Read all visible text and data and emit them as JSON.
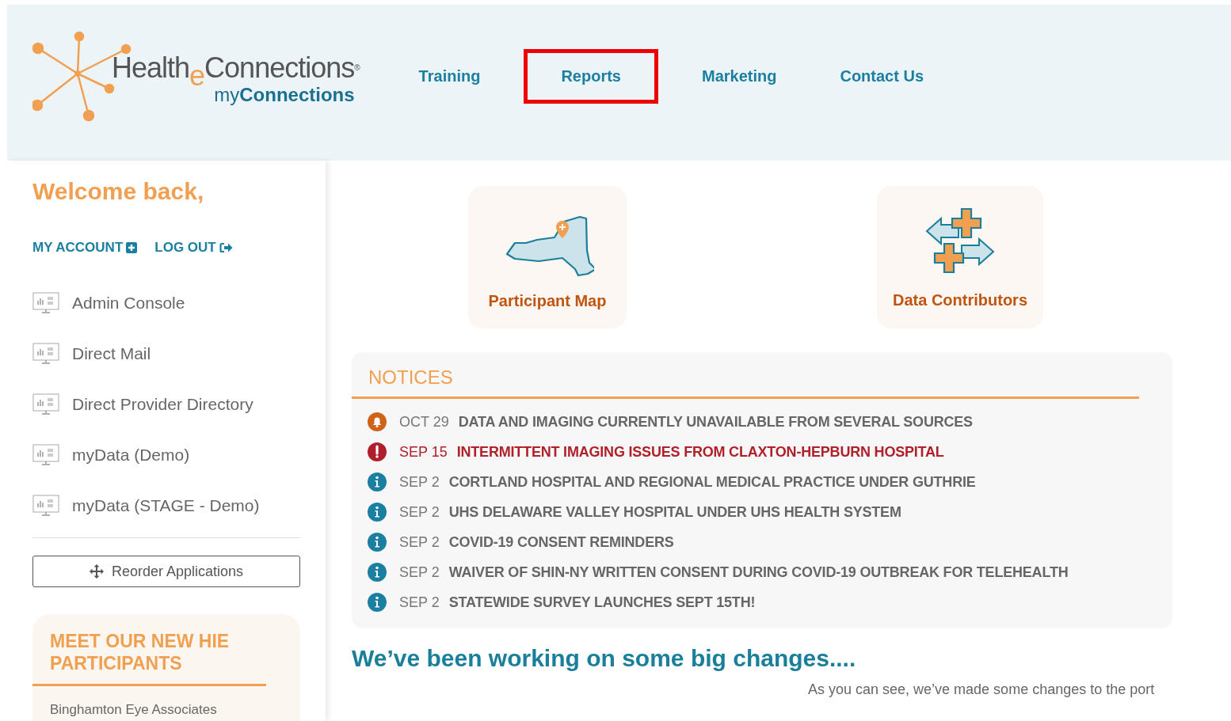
{
  "logo": {
    "word_start": "Health",
    "word_accent": "e",
    "word_end": "Connections",
    "registered": "®",
    "tagline": "my**Connections**"
  },
  "nav": [
    {
      "label": "Training",
      "selected": false
    },
    {
      "label": "Reports",
      "selected": true
    },
    {
      "label": "Marketing",
      "selected": false
    },
    {
      "label": "Contact Us",
      "selected": false
    }
  ],
  "sidebar": {
    "greeting": "Welcome back,",
    "account_links": [
      {
        "label": "MY ACCOUNT",
        "kind": "account"
      },
      {
        "label": "LOG OUT",
        "kind": "logout"
      }
    ],
    "applications": [
      "Admin Console",
      "Direct Mail",
      "Direct Provider Directory",
      "myData (Demo)",
      "myData (STAGE - Demo)"
    ],
    "reorder_button": "Reorder Applications",
    "participants_card": {
      "title": "MEET OUR NEW HIE PARTICIPANTS",
      "items": [
        "Binghamton Eye Associates"
      ]
    }
  },
  "tiles": [
    {
      "label": "Participant Map",
      "kind": "map"
    },
    {
      "label": "Data Contributors",
      "kind": "contributors"
    }
  ],
  "notices": {
    "title": "NOTICES",
    "items": [
      {
        "kind": "warning",
        "date": "OCT 29",
        "text": "DATA AND IMAGING CURRENTLY UNAVAILABLE FROM SEVERAL SOURCES"
      },
      {
        "kind": "alert",
        "date": "SEP 15",
        "text": "INTERMITTENT IMAGING ISSUES FROM CLAXTON-HEPBURN HOSPITAL"
      },
      {
        "kind": "info",
        "date": "SEP 2",
        "text": "CORTLAND HOSPITAL AND REGIONAL MEDICAL PRACTICE UNDER GUTHRIE"
      },
      {
        "kind": "info",
        "date": "SEP 2",
        "text": "UHS DELAWARE VALLEY HOSPITAL UNDER UHS HEALTH SYSTEM"
      },
      {
        "kind": "info",
        "date": "SEP 2",
        "text": "COVID-19 CONSENT REMINDERS"
      },
      {
        "kind": "info",
        "date": "SEP 2",
        "text": "WAIVER OF SHIN-NY WRITTEN CONSENT DURING COVID-19 OUTBREAK FOR TELEHEALTH"
      },
      {
        "kind": "info",
        "date": "SEP 2",
        "text": "STATEWIDE SURVEY LAUNCHES SEPT 15TH!"
      }
    ]
  },
  "changes": {
    "heading": "We’ve been working on some big changes....",
    "body": "As you can see, we’ve made some changes to the port"
  }
}
